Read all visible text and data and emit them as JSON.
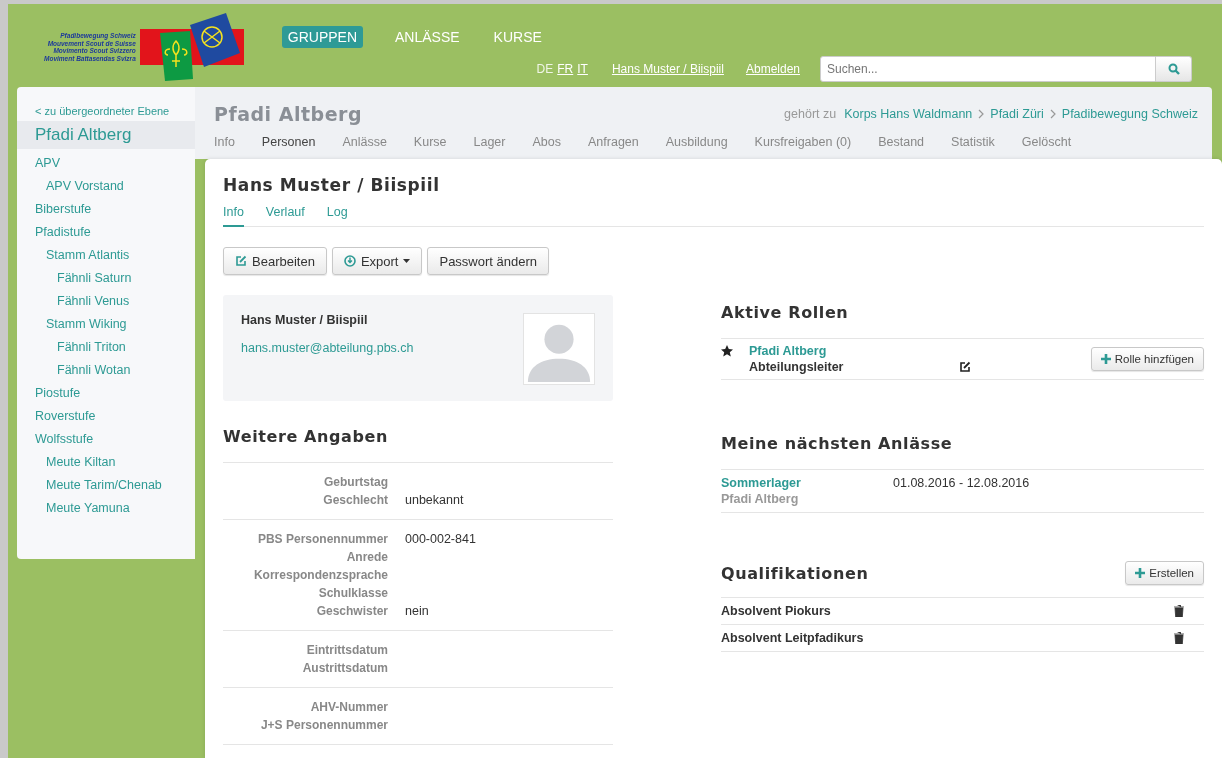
{
  "logo": {
    "lines": [
      "Pfadibewegung Schweiz",
      "Mouvement Scout de Suisse",
      "Movimento Scout Svizzero",
      "Moviment Battasendas Svizra"
    ]
  },
  "main_nav": [
    {
      "label": "GRUPPEN",
      "selected": true
    },
    {
      "label": "ANLÄSSE",
      "selected": false
    },
    {
      "label": "KURSE",
      "selected": false
    }
  ],
  "languages": [
    {
      "label": "DE",
      "selected": true
    },
    {
      "label": "FR",
      "selected": false
    },
    {
      "label": "IT",
      "selected": false
    }
  ],
  "user_link": "Hans Muster / Biispiil",
  "logout_link": "Abmelden",
  "search": {
    "placeholder": "Suchen..."
  },
  "sidebar": {
    "back_link": "< zu übergeordneter Ebene",
    "current": "Pfadi Altberg",
    "items": [
      {
        "label": "APV",
        "children": [
          {
            "label": "APV Vorstand"
          }
        ]
      },
      {
        "label": "Biberstufe"
      },
      {
        "label": "Pfadistufe",
        "children": [
          {
            "label": "Stamm Atlantis",
            "children": [
              {
                "label": "Fähnli Saturn"
              },
              {
                "label": "Fähnli Venus"
              }
            ]
          },
          {
            "label": "Stamm Wiking",
            "children": [
              {
                "label": "Fähnli Triton"
              },
              {
                "label": "Fähnli Wotan"
              }
            ]
          }
        ]
      },
      {
        "label": "Piostufe"
      },
      {
        "label": "Roverstufe"
      },
      {
        "label": "Wolfsstufe",
        "children": [
          {
            "label": "Meute Kiltan"
          },
          {
            "label": "Meute Tarim/Chenab"
          },
          {
            "label": "Meute Yamuna"
          }
        ]
      }
    ]
  },
  "group": {
    "title": "Pfadi Altberg",
    "belongs_to_label": "gehört zu",
    "breadcrumbs": [
      "Korps Hans Waldmann",
      "Pfadi Züri",
      "Pfadibewegung Schweiz"
    ],
    "tabs": [
      {
        "label": "Info",
        "selected": false
      },
      {
        "label": "Personen",
        "selected": true
      },
      {
        "label": "Anlässe",
        "selected": false
      },
      {
        "label": "Kurse",
        "selected": false
      },
      {
        "label": "Lager",
        "selected": false
      },
      {
        "label": "Abos",
        "selected": false
      },
      {
        "label": "Anfragen",
        "selected": false
      },
      {
        "label": "Ausbildung",
        "selected": false
      },
      {
        "label": "Kursfreigaben (0)",
        "selected": false
      },
      {
        "label": "Bestand",
        "selected": false
      },
      {
        "label": "Statistik",
        "selected": false
      },
      {
        "label": "Gelöscht",
        "selected": false
      }
    ]
  },
  "person": {
    "title": "Hans Muster / Biispiil",
    "tabs": [
      {
        "label": "Info",
        "selected": true
      },
      {
        "label": "Verlauf",
        "selected": false
      },
      {
        "label": "Log",
        "selected": false
      }
    ],
    "actions": [
      {
        "kind": "edit",
        "label": "Bearbeiten"
      },
      {
        "kind": "export",
        "label": "Export"
      },
      {
        "kind": "plain",
        "label": "Passwort ändern"
      }
    ],
    "card": {
      "name": "Hans Muster / Biispiil",
      "email": "hans.muster@abteilung.pbs.ch"
    },
    "details_title": "Weitere Angaben",
    "details": [
      [
        {
          "label": "Geburtstag"
        },
        {
          "label": "Geschlecht",
          "value": "unbekannt"
        }
      ],
      [
        {
          "label": "PBS Personennummer",
          "value": "000-002-841"
        },
        {
          "label": "Anrede"
        },
        {
          "label": "Korrespondenzsprache"
        },
        {
          "label": "Schulklasse"
        },
        {
          "label": "Geschwister",
          "value": "nein"
        }
      ],
      [
        {
          "label": "Eintrittsdatum"
        },
        {
          "label": "Austrittsdatum"
        }
      ],
      [
        {
          "label": "AHV-Nummer"
        },
        {
          "label": "J+S Personennummer"
        }
      ]
    ],
    "roles": {
      "title": "Aktive Rollen",
      "add_button": "Rolle hinzfügen",
      "items": [
        {
          "group": "Pfadi Altberg",
          "role": "Abteilungsleiter",
          "primary": true
        }
      ]
    },
    "events": {
      "title": "Meine nächsten Anlässe",
      "items": [
        {
          "name": "Sommerlager",
          "group": "Pfadi Altberg",
          "dates": "01.08.2016 - 12.08.2016"
        }
      ]
    },
    "qualifications": {
      "title": "Qualifikationen",
      "add_button": "Erstellen",
      "items": [
        {
          "name": "Absolvent Piokurs"
        },
        {
          "name": "Absolvent Leitpfadikurs"
        }
      ]
    }
  }
}
